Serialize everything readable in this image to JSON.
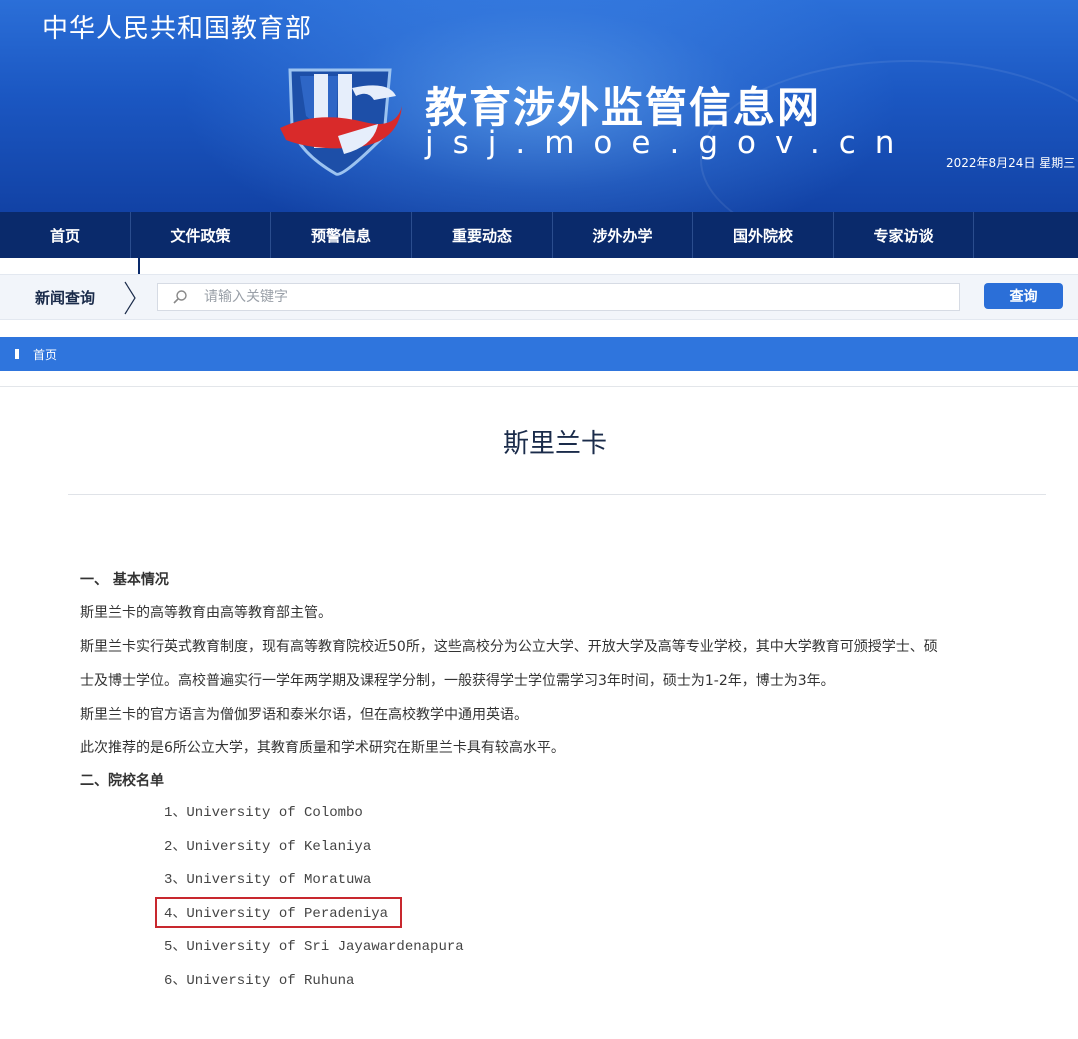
{
  "header": {
    "ministry": "中华人民共和国教育部",
    "site_title": "教育涉外监管信息网",
    "site_domain": "jsj.moe.gov.cn",
    "date": "2022年8月24日  星期三",
    "logo_icon": "jsj-shield-logo-icon"
  },
  "nav": {
    "items": [
      {
        "label": "首页"
      },
      {
        "label": "文件政策"
      },
      {
        "label": "预警信息"
      },
      {
        "label": "重要动态"
      },
      {
        "label": "涉外办学"
      },
      {
        "label": "国外院校"
      },
      {
        "label": "专家访谈"
      }
    ]
  },
  "search": {
    "label": "新闻查询",
    "placeholder": "请输入关键字",
    "button_label": "查询"
  },
  "breadcrumb": {
    "home": "首页"
  },
  "article": {
    "title": "斯里兰卡",
    "section1_heading": "一、  基本情况",
    "p1": "斯里兰卡的高等教育由高等教育部主管。",
    "p2_line1": "斯里兰卡实行英式教育制度，现有高等教育院校近50所，这些高校分为公立大学、开放大学及高等专业学校，其中大学教育可颁授学士、硕",
    "p2_line2": "士及博士学位。高校普遍实行一学年两学期及课程学分制，一般获得学士学位需学习3年时间，硕士为1-2年，博士为3年。",
    "p3": "斯里兰卡的官方语言为僧伽罗语和泰米尔语，但在高校教学中通用英语。",
    "p4": "此次推荐的是6所公立大学，其教育质量和学术研究在斯里兰卡具有较高水平。",
    "section2_heading": "二、院校名单",
    "universities": [
      "1、University of Colombo",
      "2、University of Kelaniya",
      "3、University of Moratuwa",
      "4、University of Peradeniya",
      "5、University of Sri Jayawardenapura",
      "6、University of Ruhuna"
    ]
  },
  "colors": {
    "nav_bg": "#0a2a6b",
    "accent": "#2f75dd",
    "highlight": "#c8282e"
  }
}
